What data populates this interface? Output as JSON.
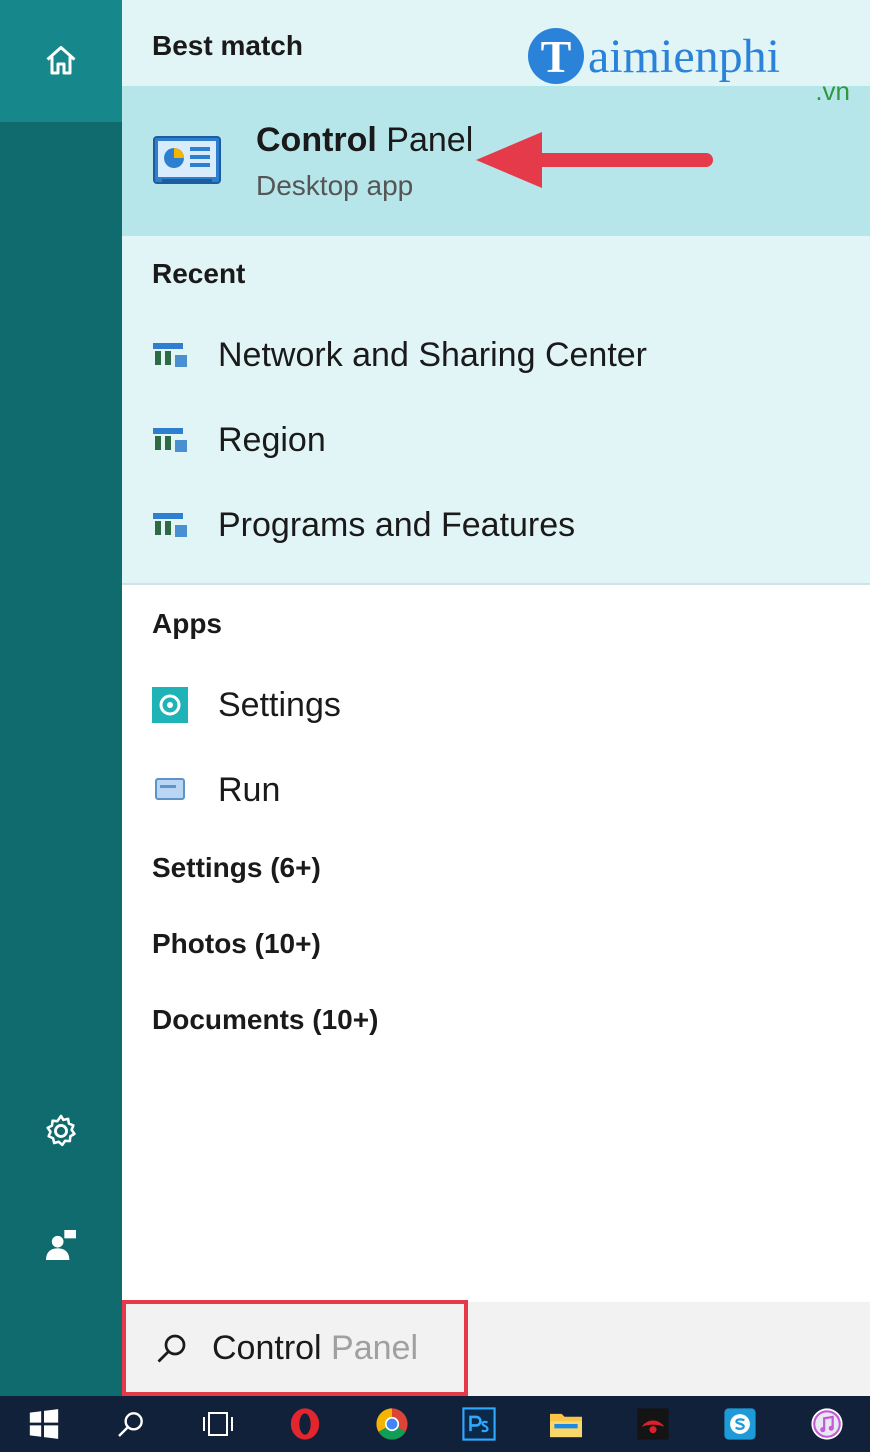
{
  "best_match": {
    "header": "Best match",
    "title_bold": "Control",
    "title_rest": " Panel",
    "subtitle": "Desktop app"
  },
  "recent": {
    "header": "Recent",
    "items": [
      "Network and Sharing Center",
      "Region",
      "Programs and Features"
    ]
  },
  "apps": {
    "header": "Apps",
    "items": [
      "Settings",
      "Run"
    ]
  },
  "more": [
    "Settings (6+)",
    "Photos (10+)",
    "Documents (10+)"
  ],
  "search": {
    "typed": "Control",
    "suggestion": " Panel"
  },
  "watermark": {
    "initial": "T",
    "name": "aimienphi",
    "suffix": ".vn"
  },
  "colors": {
    "rail": "#0f6b6e",
    "rail_home": "#16878a",
    "best_highlight": "#b7e6ea",
    "recent_bg": "#e1f4f6",
    "annotation_red": "#e53a4a",
    "taskbar": "#12213a"
  },
  "taskbar_icons": [
    "windows-icon",
    "search-icon",
    "task-view-icon",
    "opera-icon",
    "chrome-icon",
    "photoshop-icon",
    "file-explorer-icon",
    "game-icon",
    "skype-icon",
    "itunes-icon"
  ]
}
